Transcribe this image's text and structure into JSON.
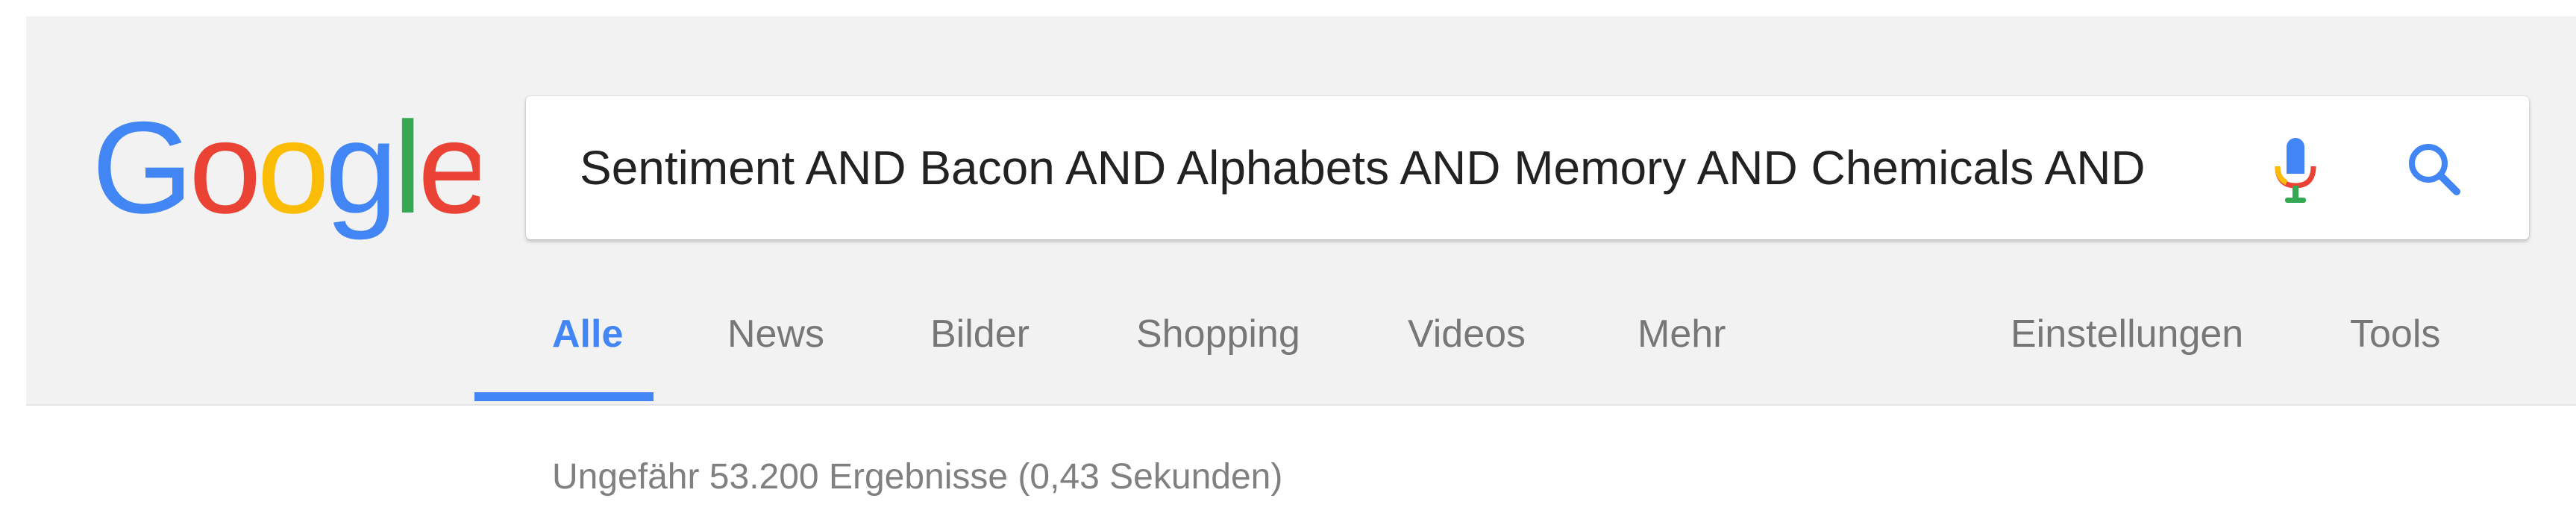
{
  "logo": {
    "alt": "Google",
    "letters": [
      "G",
      "o",
      "o",
      "g",
      "l",
      "e"
    ],
    "colors": [
      "#4285f4",
      "#ea4335",
      "#fbbc05",
      "#4285f4",
      "#34a853",
      "#ea4335"
    ]
  },
  "search": {
    "query": "Sentiment AND Bacon AND Alphabets AND Memory AND Chemicals AND",
    "mic_icon": "microphone-icon",
    "search_icon": "search-icon"
  },
  "tabs": {
    "items": [
      {
        "label": "Alle",
        "active": true
      },
      {
        "label": "News",
        "active": false
      },
      {
        "label": "Bilder",
        "active": false
      },
      {
        "label": "Shopping",
        "active": false
      },
      {
        "label": "Videos",
        "active": false
      },
      {
        "label": "Mehr",
        "active": false
      }
    ],
    "right": [
      {
        "label": "Einstellungen"
      },
      {
        "label": "Tools"
      }
    ]
  },
  "results": {
    "stats": "Ungefähr 53.200 Ergebnisse (0,43 Sekunden)"
  },
  "colors": {
    "accent": "#4285f4",
    "header_bg": "#f2f2f2",
    "tab_text": "#777777",
    "stats_text": "#808080"
  }
}
